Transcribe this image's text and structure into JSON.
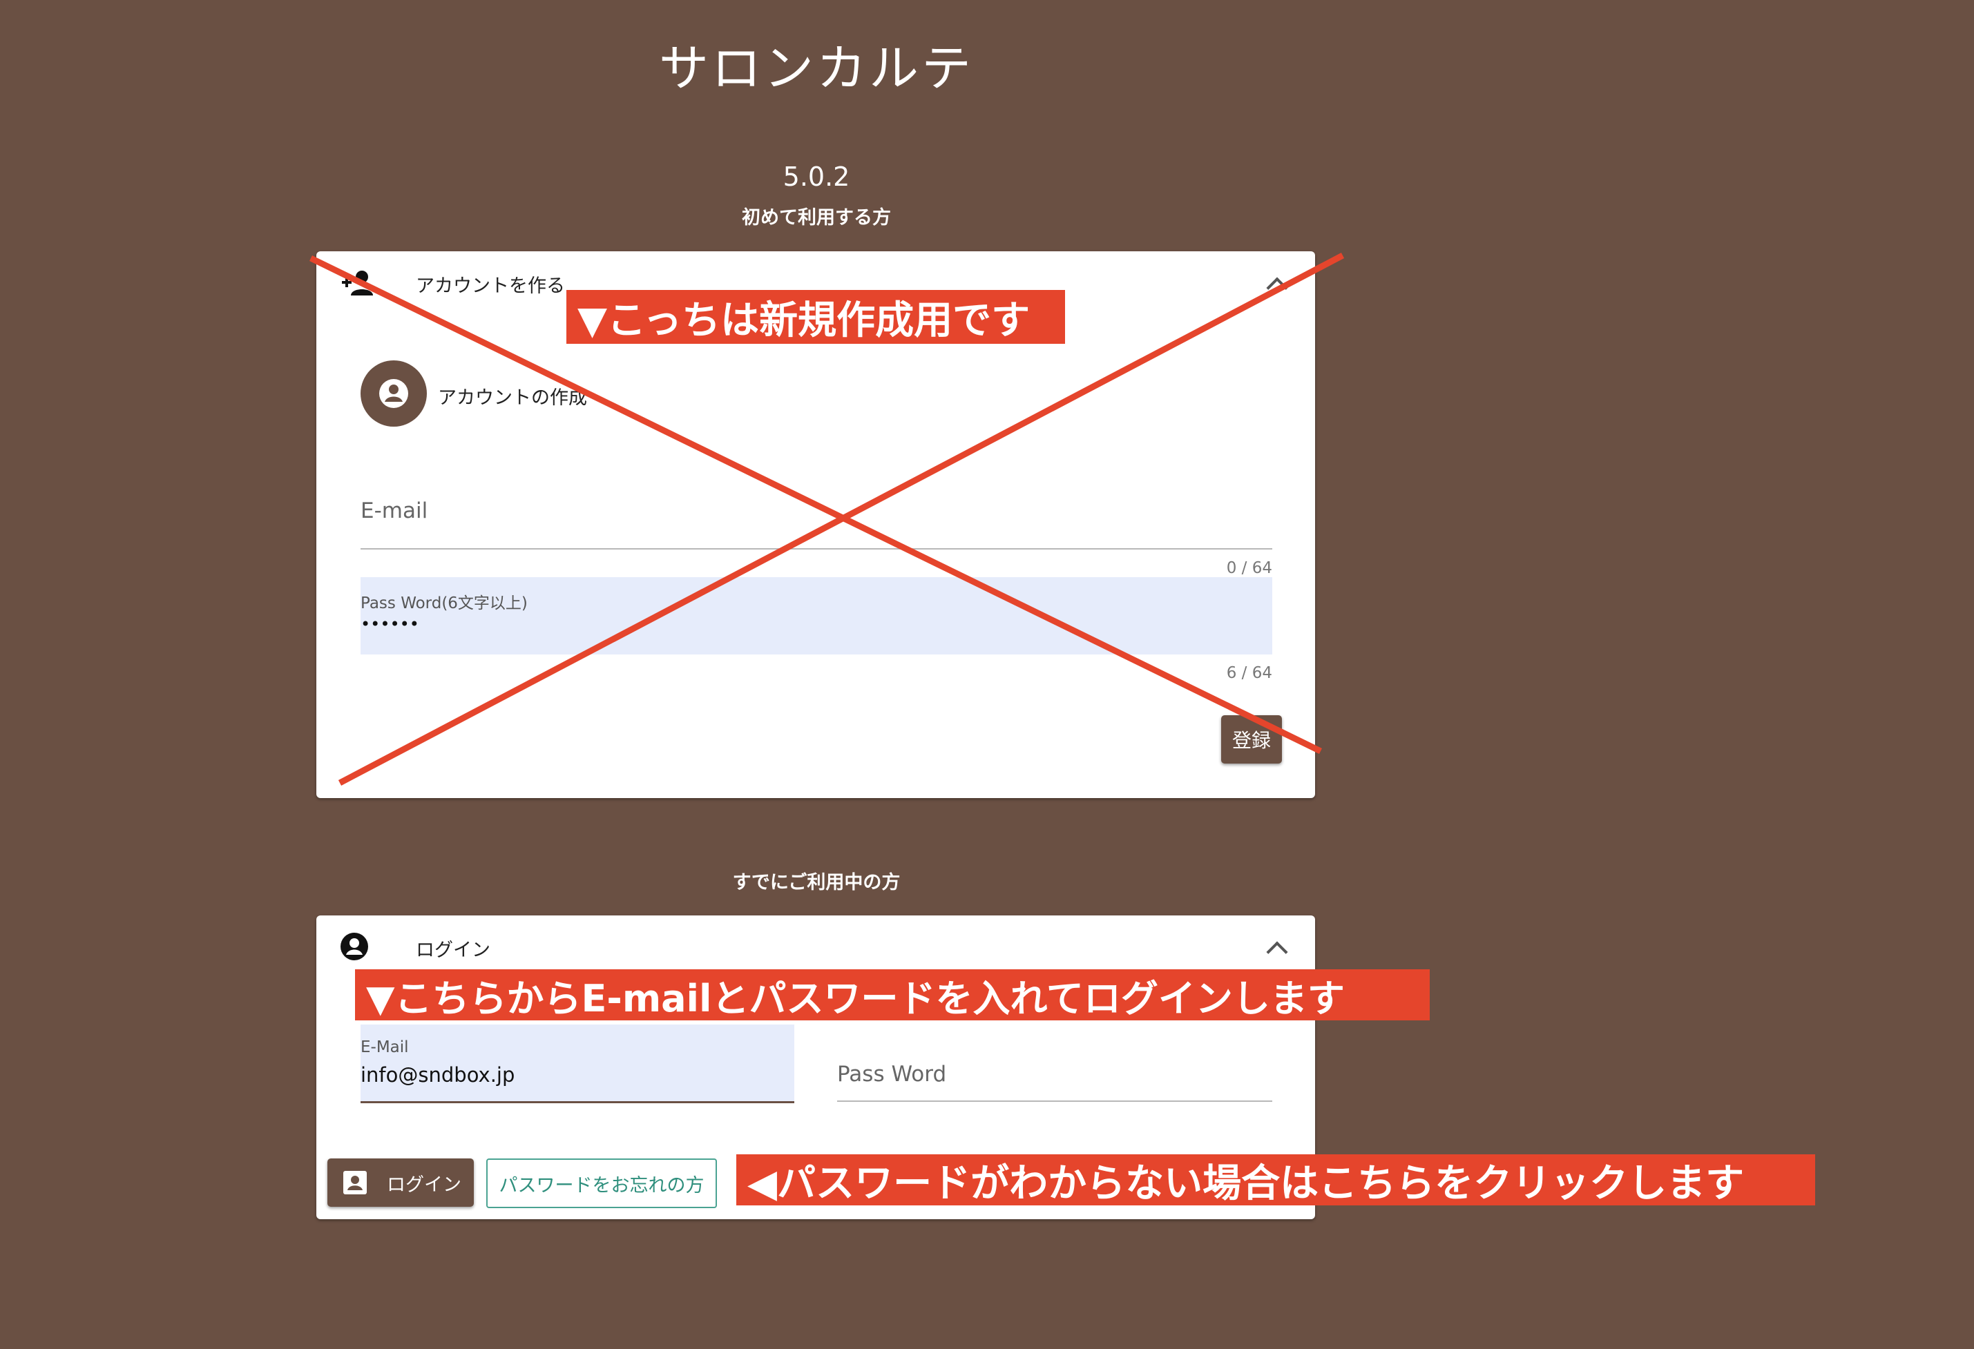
{
  "app": {
    "title": "サロンカルテ",
    "version": "5.0.2"
  },
  "new_user": {
    "caption": "初めて利用する方",
    "panel_title": "アカウントを作る",
    "section_title": "アカウントの作成",
    "email_placeholder": "E-mail",
    "email_counter": "0 / 64",
    "password_label": "Pass Word(6文字以上)",
    "password_value": "••••••",
    "password_counter": "6 / 64",
    "register_label": "登録"
  },
  "existing_user": {
    "caption": "すでにご利用中の方",
    "panel_title": "ログイン",
    "email_label": "E-Mail",
    "email_value": "info@sndbox.jp",
    "password_placeholder": "Pass Word",
    "login_label": "ログイン",
    "forgot_label": "パスワードをお忘れの方"
  },
  "annotations": {
    "new_account_note": "▼こっちは新規作成用です",
    "login_note": "▼こちらからE-mailとパスワードを入れてログインします",
    "forgot_note": "◀パスワードがわからない場合はこちらをクリックします"
  },
  "colors": {
    "background": "#6a5043",
    "annotation": "#e5452c",
    "field_fill": "#e6ecfb",
    "outline_teal": "#4aa392"
  }
}
